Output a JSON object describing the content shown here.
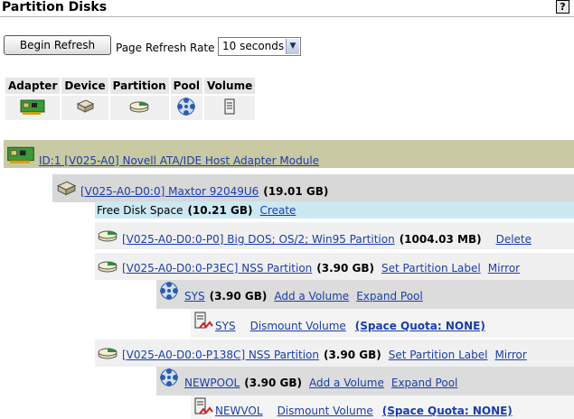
{
  "page": {
    "title": "Partition Disks",
    "help": "?"
  },
  "controls": {
    "refresh_label": "Begin Refresh",
    "rate_label": "Page Refresh Rate",
    "rate_value": "10 seconds"
  },
  "legend": [
    "Adapter",
    "Device",
    "Partition",
    "Pool",
    "Volume"
  ],
  "tree": {
    "adapter": {
      "label": "ID:1 [V025-A0] Novell ATA/IDE Host Adapter Module",
      "icon": "adapter-icon"
    },
    "device": {
      "label": "[V025-A0-D0:0] Maxtor 92049U6",
      "size": "(19.01 GB)",
      "icon": "disk-drive-icon"
    },
    "free": {
      "label": "Free Disk Space",
      "size": "(10.21 GB)",
      "action": "Create"
    },
    "partition1": {
      "label": "[V025-A0-D0:0-P0] Big DOS; OS/2; Win95 Partition",
      "size": "(1004.03 MB)",
      "delete": "Delete"
    },
    "partition2": {
      "label": "[V025-A0-D0:0-P3EC] NSS Partition",
      "size": "(3.90 GB)",
      "set_label": "Set Partition Label",
      "mirror": "Mirror"
    },
    "pool1": {
      "label": "SYS",
      "size": "(3.90 GB)",
      "add_volume": "Add a Volume",
      "expand": "Expand Pool"
    },
    "volume1": {
      "label": "SYS",
      "dismount": "Dismount Volume",
      "quota": "(Space Quota: NONE)"
    },
    "partition3": {
      "label": "[V025-A0-D0:0-P138C] NSS Partition",
      "size": "(3.90 GB)",
      "set_label": "Set Partition Label",
      "mirror": "Mirror"
    },
    "pool2": {
      "label": "NEWPOOL",
      "size": "(3.90 GB)",
      "add_volume": "Add a Volume",
      "expand": "Expand Pool"
    },
    "volume2": {
      "label": "NEWVOL",
      "dismount": "Dismount Volume",
      "quota": "(Space Quota: NONE)"
    }
  }
}
